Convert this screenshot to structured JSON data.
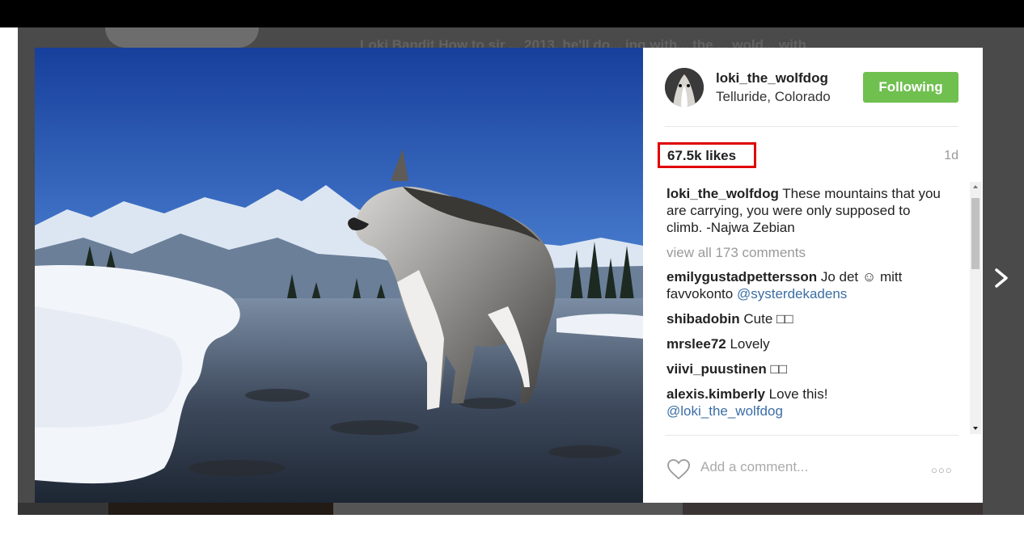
{
  "background": {
    "caption_fragment": "Loki Bandit How to sir ... 2013, he'll do... ing with... the ... wold... with"
  },
  "post": {
    "username": "loki_the_wolfdog",
    "location": "Telluride, Colorado",
    "follow_label": "Following",
    "likes": "67.5k likes",
    "age": "1d",
    "caption_user": "loki_the_wolfdog",
    "caption_text": "These mountains that you are carrying, you were only supposed to climb. -Najwa Zebian",
    "view_all": "view all 173 comments",
    "comments": [
      {
        "user": "emilygustadpettersson",
        "text": "Jo det ☺ mitt favvokonto",
        "mention": "@systerdekadens"
      },
      {
        "user": "shibadobin",
        "text": "Cute □□",
        "mention": ""
      },
      {
        "user": "mrslee72",
        "text": "Lovely",
        "mention": ""
      },
      {
        "user": "viivi_puustinen",
        "text": "□□",
        "mention": ""
      },
      {
        "user": "alexis.kimberly",
        "text": "Love this!",
        "mention": "@loki_the_wolfdog"
      }
    ],
    "comment_placeholder": "Add a comment...",
    "more_label": "○○○"
  },
  "icons": {
    "heart": "heart-icon",
    "more": "more-options-icon",
    "next": "chevron-right-icon"
  },
  "colors": {
    "follow_button": "#70c050",
    "highlight_box": "#e00000",
    "mention": "#3b6ea5"
  }
}
